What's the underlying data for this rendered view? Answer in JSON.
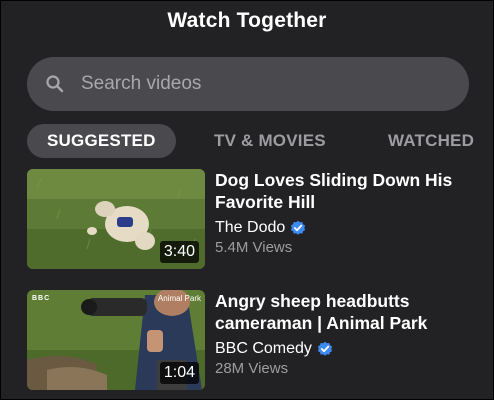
{
  "header": {
    "title": "Watch Together"
  },
  "search": {
    "placeholder": "Search videos",
    "icon": "search-icon"
  },
  "tabs": [
    {
      "label": "SUGGESTED",
      "active": true
    },
    {
      "label": "TV & MOVIES",
      "active": false
    },
    {
      "label": "WATCHED",
      "active": false
    }
  ],
  "videos": [
    {
      "title": "Dog Loves Sliding Down His Favorite Hill",
      "channel": "The Dodo",
      "verified": true,
      "views": "5.4M Views",
      "duration": "3:40"
    },
    {
      "title": "Angry sheep headbutts cameraman | Animal Park",
      "channel": "BBC Comedy",
      "verified": true,
      "views": "28M Views",
      "duration": "1:04",
      "thumb_logo": "BBC",
      "thumb_show": "Animal Park"
    }
  ],
  "colors": {
    "background": "#222224",
    "chip": "#4a4a4e",
    "muted_text": "#9d9da1",
    "verified_badge": "#3d8bf2"
  }
}
